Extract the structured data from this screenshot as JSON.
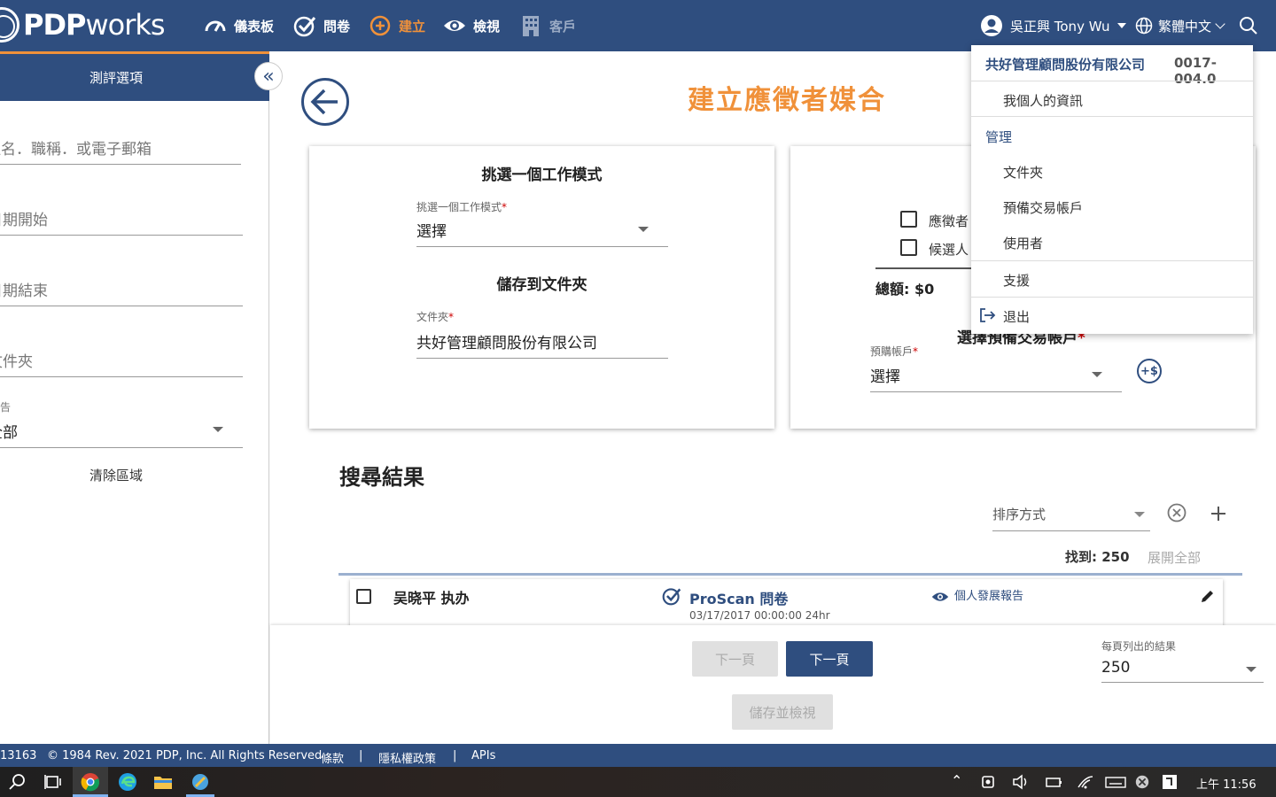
{
  "nav": {
    "logo_bold": "PDP",
    "logo_thin": "works",
    "dashboard": "儀表板",
    "survey": "問卷",
    "create": "建立",
    "view": "檢視",
    "clients": "客戶",
    "user": "吳正興 Tony Wu",
    "language": "繁體中文"
  },
  "sidebar": {
    "title": "測評選項",
    "search_placeholder": "姓名．職稱．或電子郵箱",
    "date_start": "日期開始",
    "date_end": "日期結束",
    "folder": "文件夾",
    "report_label": "報告",
    "report_value": "全部",
    "clear": "清除區域"
  },
  "main": {
    "title": "建立應徵者媒合",
    "card1": {
      "heading1": "挑選一個工作模式",
      "mode_label": "挑選一個工作模式",
      "mode_value": "選擇",
      "heading2": "儲存到文件夾",
      "folder_label": "文件夾",
      "folder_value": "共好管理顧問股份有限公司"
    },
    "card2": {
      "check1": "應徵者",
      "check2": "候選人",
      "total": "總額: $0",
      "account_heading": "選擇預備交易帳戶",
      "account_label": "預購帳戶",
      "account_value": "選擇",
      "add_funds_icon": "+$"
    },
    "results_title": "搜尋結果",
    "sort_placeholder": "排序方式",
    "found": "找到: 250",
    "expand_all": "展開全部",
    "row": {
      "name": "吴晓平 执办",
      "survey": "ProScan 問卷",
      "date": "03/17/2017 00:00:00 24hr",
      "report": "個人發展報告"
    }
  },
  "pagination": {
    "prev": "下一頁",
    "next": "下一頁",
    "save_view": "儲存並檢視",
    "per_page_label": "每頁列出的結果",
    "per_page_value": "250"
  },
  "dropdown": {
    "company": "共好管理顧問股份有限公司",
    "company_code": "0017-004.0",
    "my_info": "我個人的資訊",
    "manage": "管理",
    "folders": "文件夾",
    "prepaid": "預備交易帳戶",
    "users": "使用者",
    "support": "支援",
    "logout": "退出"
  },
  "footer": {
    "id": "13163",
    "copyright": "© 1984 Rev. 2021 PDP, Inc. All Rights Reserved",
    "terms": "條款",
    "sep": "|",
    "privacy": "隱私權政策",
    "apis": "APIs"
  },
  "taskbar": {
    "clock": "上午 11:56"
  },
  "colors": {
    "nav_blue": "#2f4e7f",
    "accent_orange": "#f0913a"
  }
}
